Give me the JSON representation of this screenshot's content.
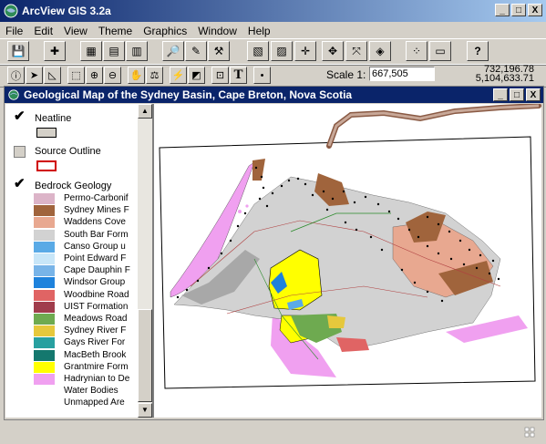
{
  "app": {
    "title": "ArcView GIS 3.2a",
    "window_buttons": [
      "_",
      "□",
      "X"
    ]
  },
  "menubar": [
    "File",
    "Edit",
    "View",
    "Theme",
    "Graphics",
    "Window",
    "Help"
  ],
  "toolbar": {
    "buttons": [
      {
        "name": "save-icon",
        "glyph": "💾"
      },
      {
        "name": "add-theme-icon",
        "glyph": "✚"
      },
      {
        "name": "theme-properties-icon",
        "glyph": "▦"
      },
      {
        "name": "edit-legend-icon",
        "glyph": "▤"
      },
      {
        "name": "open-table-icon",
        "glyph": "▥"
      },
      {
        "name": "find-icon",
        "glyph": "🔎"
      },
      {
        "name": "locate-address-icon",
        "glyph": "✎"
      },
      {
        "name": "query-builder-icon",
        "glyph": "⚒"
      },
      {
        "name": "zoom-to-full-extent-icon",
        "glyph": "▧"
      },
      {
        "name": "zoom-to-themes-icon",
        "glyph": "▨"
      },
      {
        "name": "zoom-to-selected-icon",
        "glyph": "✛"
      },
      {
        "name": "zoom-in-fixed-icon",
        "glyph": "✥"
      },
      {
        "name": "zoom-out-fixed-icon",
        "glyph": "⤧"
      },
      {
        "name": "zoom-previous-icon",
        "glyph": "◈"
      },
      {
        "name": "select-by-theme-icon",
        "glyph": "⁘"
      },
      {
        "name": "clear-selection-icon",
        "glyph": "▭"
      },
      {
        "name": "help-icon",
        "glyph": "?"
      }
    ]
  },
  "tools": {
    "buttons": [
      {
        "name": "identify-tool-icon",
        "glyph": "ⓘ"
      },
      {
        "name": "pointer-tool-icon",
        "glyph": "➤"
      },
      {
        "name": "vertex-edit-tool-icon",
        "glyph": "◺"
      },
      {
        "name": "select-feature-tool-icon",
        "glyph": "⬚"
      },
      {
        "name": "zoom-in-tool-icon",
        "glyph": "⊕"
      },
      {
        "name": "zoom-out-tool-icon",
        "glyph": "⊖"
      },
      {
        "name": "pan-tool-icon",
        "glyph": "✋"
      },
      {
        "name": "measure-tool-icon",
        "glyph": "⚖"
      },
      {
        "name": "hotlink-tool-icon",
        "glyph": "⚡"
      },
      {
        "name": "area-of-interest-tool-icon",
        "glyph": "◩"
      },
      {
        "name": "label-tool-icon",
        "glyph": "⊡"
      },
      {
        "name": "text-tool-icon",
        "glyph": "T"
      },
      {
        "name": "draw-point-tool-icon",
        "glyph": "•"
      }
    ],
    "scale_label": "Scale 1:",
    "scale_value": "667,505",
    "coord_x": "732,196.78",
    "coord_y": "5,104,633.71"
  },
  "view": {
    "title": "Geological Map of the Sydney Basin, Cape Breton, Nova Scotia"
  },
  "toc": {
    "themes": [
      {
        "name": "Neatline",
        "checked": true
      },
      {
        "name": "Source Outline",
        "checked": false
      },
      {
        "name": "Bedrock Geology",
        "checked": true
      }
    ],
    "classes": [
      {
        "label": "Permo-Carbonif",
        "color": "#dcb4c8"
      },
      {
        "label": "Sydney Mines F",
        "color": "#a0643c"
      },
      {
        "label": "Waddens Cove",
        "color": "#e8a890"
      },
      {
        "label": "South Bar Form",
        "color": "#d2d2d2"
      },
      {
        "label": "Canso Group u",
        "color": "#5aaae6"
      },
      {
        "label": "Point Edward F",
        "color": "#c8e6f8"
      },
      {
        "label": "Cape Dauphin F",
        "color": "#78b4e8"
      },
      {
        "label": "Windsor Group",
        "color": "#1e82dc"
      },
      {
        "label": "Woodbine Road",
        "color": "#e06464"
      },
      {
        "label": "UIST Formation",
        "color": "#a03c4c"
      },
      {
        "label": "Meadows Road",
        "color": "#6eaa50"
      },
      {
        "label": "Sydney River F",
        "color": "#e6c83c"
      },
      {
        "label": "Gays River For",
        "color": "#28a0a0"
      },
      {
        "label": "MacBeth Brook",
        "color": "#14786e"
      },
      {
        "label": "Grantmire Form",
        "color": "#ffff00"
      },
      {
        "label": "Hadrynian to De",
        "color": "#f0a0f0"
      },
      {
        "label": "Water Bodies",
        "color": "#ffffff"
      },
      {
        "label": "Unmapped Are",
        "color": "#ffffff"
      }
    ]
  },
  "colors": {
    "titlebar_start": "#0a246a",
    "titlebar_end": "#a6caf0",
    "face": "#d4d0c8"
  }
}
